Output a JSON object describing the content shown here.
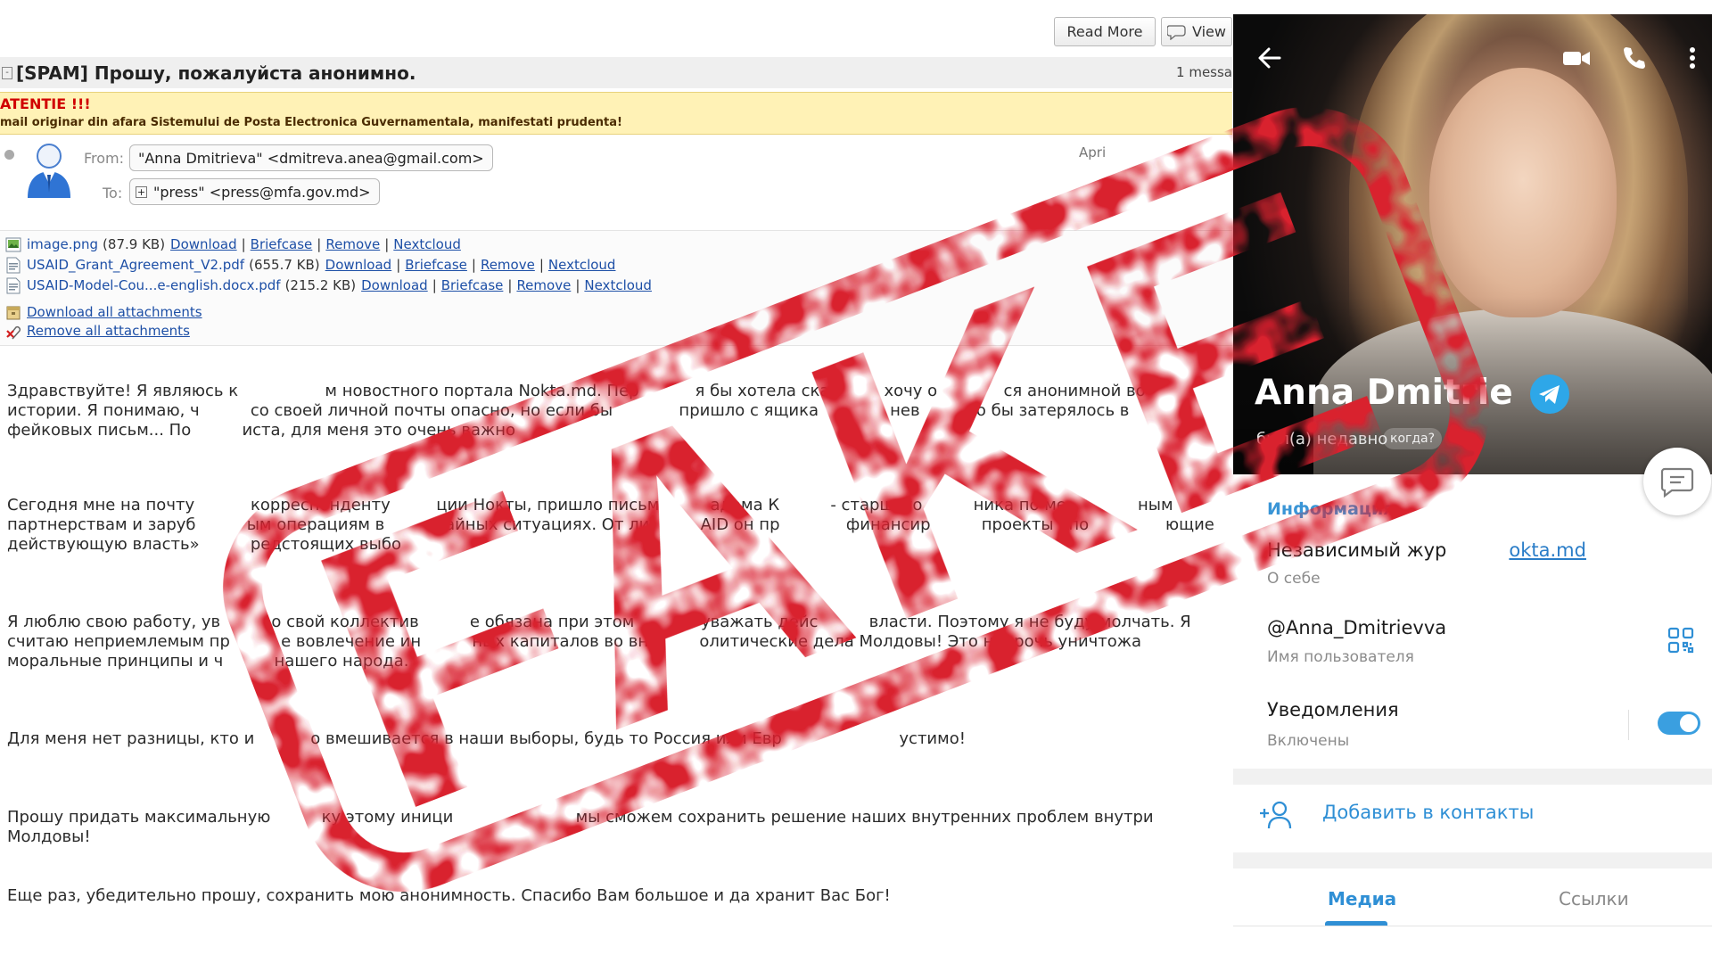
{
  "email": {
    "toolbar": {
      "read_more": "Read More",
      "view": "View"
    },
    "subject": "[SPAM] Прошу, пожалуйста анонимно.",
    "message_count": "1 messa",
    "warning": {
      "title": "ATENTIE !!!",
      "text": "mail originar din afara Sistemului de Posta Electronica Guvernamentala, manifestati prudenta!"
    },
    "from_label": "From:",
    "from_value": "\"Anna Dmitrieva\" <dmitreva.anea@gmail.com>",
    "to_label": "To:",
    "to_value": "\"press\" <press@mfa.gov.md>",
    "date": "Apri",
    "attachments": [
      {
        "name": "image.png",
        "size": "(87.9 KB)"
      },
      {
        "name": "USAID_Grant_Agreement_V2.pdf",
        "size": "(655.7 KB)"
      },
      {
        "name": "USAID-Model-Cou...e-english.docx.pdf",
        "size": "(215.2 KB)"
      }
    ],
    "attachment_actions": {
      "download": "Download",
      "briefcase": "Briefcase",
      "remove": "Remove",
      "nextcloud": "Nextcloud"
    },
    "download_all": "Download all attachments",
    "remove_all": "Remove all attachments",
    "paragraphs": [
      "Здравствуйте! Я являюсь к                 м новостного портала Nokta.md. Пер           я бы хотела сказ         хочу о             ся анонимной во\nистории. Я понимаю, ч          со своей личной почты опасно, но если бы             пришло с ящика              нев         но бы затерялось в\nфейковых письм... По          иста, для меня это очень важно",
      "Сегодня мне на почту           корреспонденту         ции Нокты, пришло письм          адама К          - старшего          ника по ме              ным\nпартнерствам и заруб          ым операциям в          чайных ситуациях. От ли          AID он пр             финансир          проекты «по               ющие\nдействующую власть»          редстоящих выбо",
      "Я люблю свою работу, ув          о свой коллектив          е обязана при этом          и уважать дейс          власти. Поэтому я не буду молчать. Я\nсчитаю неприемлемым пр          е вовлечение ин          ных капиталов во вн          олитические дела Молдовы! Это напрочь уничтожа\nморальные принципы и ч          нашего народа.",
      "Для меня нет разницы, кто и           о вмешивается в наши выборы, будь то Россия или Евр                       устимо!",
      "Прошу придать максимальную          ку этому иници                        мы сможем сохранить решение наших внутренних проблем внутри Молдовы!",
      "Еще раз, убедительно прошу, сохранить мою анонимность. Спасибо Вам большое и да хранит Вас Бог!"
    ]
  },
  "telegram": {
    "name": "Anna Dmitrie",
    "last_seen": "был(а) недавно",
    "when_label": "когда?",
    "info_title": "Информация",
    "bio_prefix": "Независимый жур",
    "bio_link": "okta.md",
    "bio_label": "О себе",
    "username": "@Anna_Dmitrievva",
    "username_label": "Имя пользователя",
    "notifications": "Уведомления",
    "notifications_state": "Включены",
    "add_contact": "Добавить в контакты",
    "tabs": [
      "Медиа",
      "Ссылки"
    ],
    "accent_color": "#2f8fd5"
  },
  "stamp": {
    "text": "FAKE",
    "color": "#d9202e"
  }
}
